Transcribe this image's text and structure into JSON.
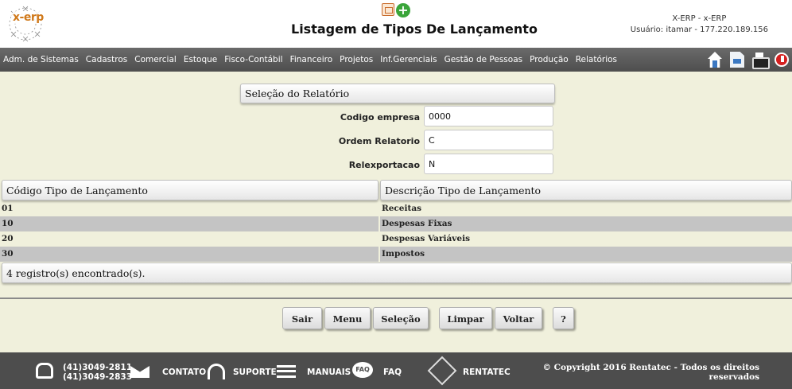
{
  "header": {
    "logo_text": "x-erp",
    "title": "Listagem de Tipos De Lançamento",
    "user_line1": "X-ERP - x-ERP",
    "user_line2": "Usuário: itamar - 177.220.189.156",
    "icons": [
      "report-icon",
      "add-icon"
    ]
  },
  "menu": {
    "items": [
      "Adm. de Sistemas",
      "Cadastros",
      "Comercial",
      "Estoque",
      "Fisco-Contábil",
      "Financeiro",
      "Projetos",
      "Inf.Gerenciais",
      "Gestão de Pessoas",
      "Produção",
      "Relatórios"
    ],
    "icons": [
      "home-icon",
      "document-icon",
      "printer-icon",
      "power-icon"
    ]
  },
  "selection": {
    "title": "Seleção do Relatório",
    "fields": [
      {
        "label": "Codigo empresa",
        "value": "0000"
      },
      {
        "label": "Ordem Relatorio",
        "value": "C"
      },
      {
        "label": "Relexportacao",
        "value": "N"
      }
    ]
  },
  "table": {
    "columns": [
      "Código Tipo de Lançamento",
      "Descrição Tipo de Lançamento"
    ],
    "rows": [
      [
        "01",
        "Receitas"
      ],
      [
        "10",
        "Despesas Fixas"
      ],
      [
        "20",
        "Despesas Variáveis"
      ],
      [
        "30",
        "Impostos"
      ]
    ],
    "count_text": "4 registro(s) encontrado(s)."
  },
  "buttons": {
    "sair": "Sair",
    "menu": "Menu",
    "selecao": "Seleção",
    "limpar": "Limpar",
    "voltar": "Voltar",
    "help": "?"
  },
  "footer": {
    "phone1": "(41)3049-2811",
    "phone2": "(41)3049-2833",
    "contato": "CONTATO",
    "suporte": "SUPORTE",
    "manuais": "MANUAIS",
    "faq": "FAQ",
    "faq_icon_text": "FAQ",
    "rentatec": "RENTATEC",
    "copyright_line1": "© Copyright 2016 Rentatec - Todos os direitos",
    "copyright_line2": "reservados"
  },
  "colors": {
    "background": "#f0f0dc",
    "menubar": "#555555",
    "row_alt": "#c4c4c4",
    "footer": "#4d4d4d"
  }
}
